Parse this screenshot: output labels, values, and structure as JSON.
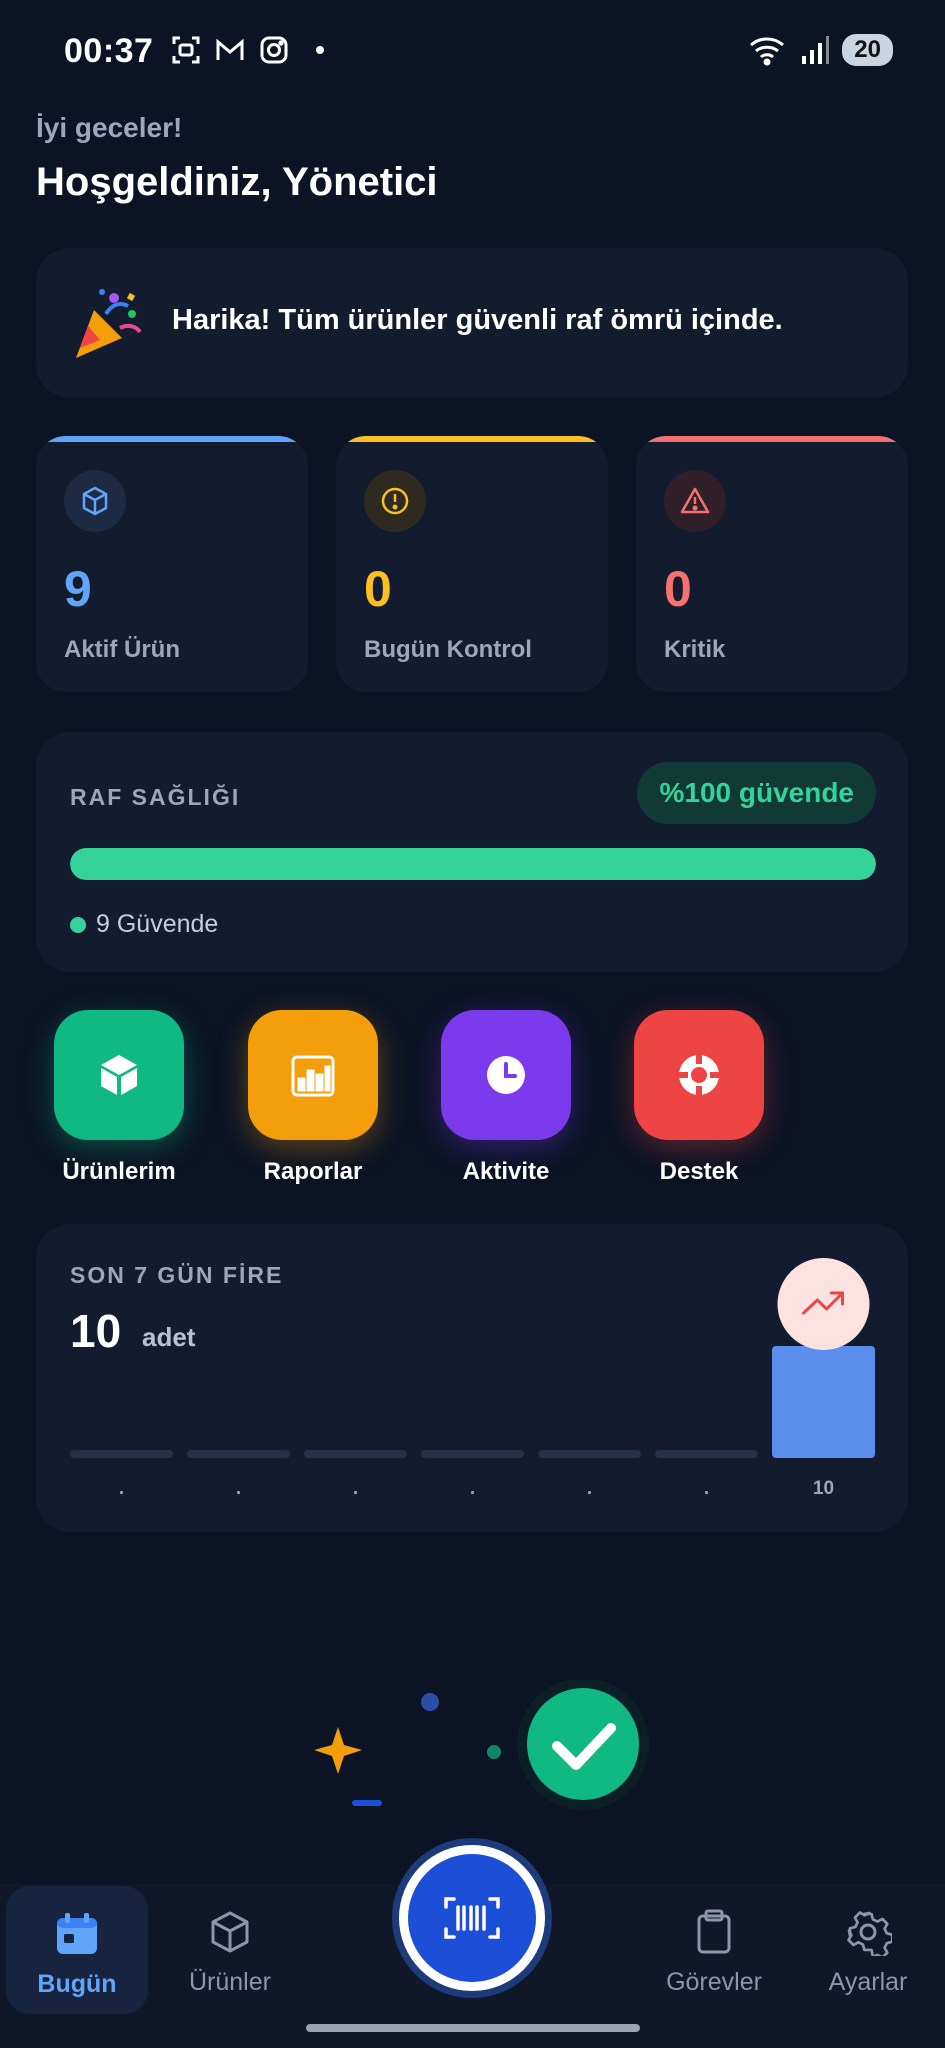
{
  "status_bar": {
    "time": "00:37",
    "battery": "20"
  },
  "header": {
    "greeting": "İyi geceler!",
    "welcome": "Hoşgeldiniz, Yönetici"
  },
  "banner": {
    "text": "Harika! Tüm ürünler güvenli raf ömrü içinde.",
    "icon": "party-popper-icon"
  },
  "stats": [
    {
      "value": "9",
      "label": "Aktif Ürün",
      "color": "#60a5fa",
      "icon": "cube-icon"
    },
    {
      "value": "0",
      "label": "Bugün Kontrol",
      "color": "#fbbf24",
      "icon": "alert-circle-icon"
    },
    {
      "value": "0",
      "label": "Kritik",
      "color": "#f87171",
      "icon": "warning-triangle-icon"
    }
  ],
  "shelf_health": {
    "title": "RAF SAĞLIĞI",
    "badge": "%100 güvende",
    "safe_fraction": 1.0,
    "legend": "9 Güvende",
    "color": "#34d399"
  },
  "quick_actions": [
    {
      "label": "Ürünlerim",
      "color": "#10b981",
      "icon": "box-icon"
    },
    {
      "label": "Raporlar",
      "color": "#f59e0b",
      "icon": "bar-chart-icon"
    },
    {
      "label": "Aktivite",
      "color": "#7c3aed",
      "icon": "clock-icon"
    },
    {
      "label": "Destek",
      "color": "#ef4444",
      "icon": "lifebuoy-icon"
    }
  ],
  "waste": {
    "title": "SON 7 GÜN FİRE",
    "value": "10",
    "unit": "adet",
    "trend_icon": "trending-up-icon"
  },
  "chart_data": {
    "type": "bar",
    "categories": [
      "",
      "",
      "",
      "",
      "",
      "",
      ""
    ],
    "values": [
      0,
      0,
      0,
      0,
      0,
      0,
      10
    ],
    "value_labels": [
      ".",
      ".",
      ".",
      ".",
      ".",
      ".",
      "10"
    ],
    "title": "SON 7 GÜN FİRE",
    "xlabel": "",
    "ylabel": "",
    "ylim": [
      0,
      10
    ],
    "bar_color": "#5b8def",
    "empty_color": "#253146"
  },
  "nav": {
    "items": [
      {
        "label": "Bugün",
        "icon": "calendar-icon",
        "active": true
      },
      {
        "label": "Ürünler",
        "icon": "cube-icon",
        "active": false
      },
      {
        "label": "Görevler",
        "icon": "clipboard-icon",
        "active": false
      },
      {
        "label": "Ayarlar",
        "icon": "gear-icon",
        "active": false
      }
    ],
    "scan_icon": "barcode-scan-icon"
  }
}
